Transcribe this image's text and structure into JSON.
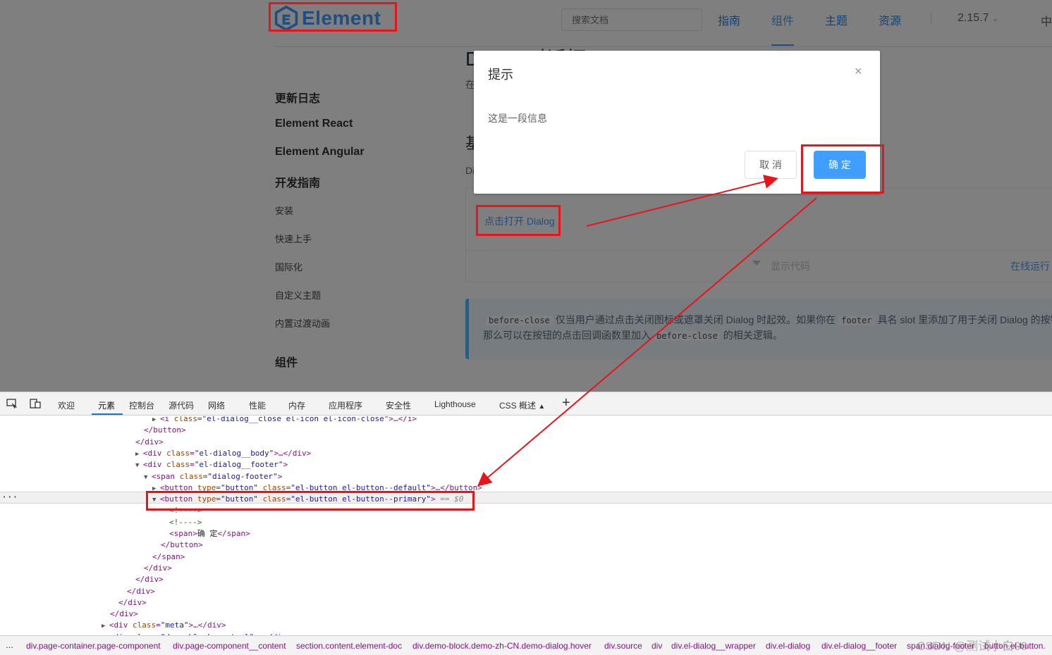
{
  "nav": {
    "logo_text": "Element",
    "search_placeholder": "搜索文档",
    "items": [
      "指南",
      "组件",
      "主题",
      "资源"
    ],
    "version": "2.15.7",
    "lang": "中"
  },
  "sidebar": {
    "groups": [
      "更新日志",
      "Element React",
      "Element Angular",
      "开发指南"
    ],
    "sub_items": [
      "安装",
      "快速上手",
      "国际化",
      "自定义主题",
      "内置过渡动画"
    ],
    "group_components": "组件"
  },
  "content": {
    "title": "Dialog 对话框",
    "intro": "在",
    "section_heading": "基",
    "section_desc": "Di",
    "open_button": "点击打开 Dialog",
    "show_code": "显示代码",
    "run_online": "在线运行",
    "tip_line1_code1": "before-close",
    "tip_line1_text1": "仅当用户通过点击关闭图标或遮罩关闭 Dialog 时起效。如果你在",
    "tip_line1_code2": "footer",
    "tip_line1_text2": "具名 slot 里添加了用于关闭 Dialog 的按钮",
    "tip_line2_text1": "那么可以在按钮的点击回调函数里加入",
    "tip_line2_code": "before-close",
    "tip_line2_text2": "的相关逻辑。"
  },
  "dialog": {
    "title": "提示",
    "close": "×",
    "body": "这是一段信息",
    "cancel": "取 消",
    "confirm": "确 定"
  },
  "devtools": {
    "tabs": [
      "欢迎",
      "元素",
      "控制台",
      "源代码",
      "网络",
      "性能",
      "内存",
      "应用程序",
      "安全性",
      "Lighthouse",
      "CSS 概述"
    ],
    "active_tab": "元素",
    "plus": "+",
    "dom_lines": [
      {
        "indent": 18,
        "tri": "▶",
        "tag_open": "<i ",
        "attr": "class",
        "val": "\"el-dialog__close el-icon el-icon-close\"",
        "rest": ">…</i>"
      },
      {
        "indent": 17,
        "tri": "",
        "tag_open": "</button>",
        "attr": "",
        "val": "",
        "rest": ""
      },
      {
        "indent": 16,
        "tri": "",
        "tag_open": "</div>",
        "attr": "",
        "val": "",
        "rest": ""
      },
      {
        "indent": 16,
        "tri": "▶",
        "tag_open": "<div ",
        "attr": "class",
        "val": "\"el-dialog__body\"",
        "rest": ">…</div>"
      },
      {
        "indent": 16,
        "tri": "▼",
        "tag_open": "<div ",
        "attr": "class",
        "val": "\"el-dialog__footer\"",
        "rest": ">"
      },
      {
        "indent": 17,
        "tri": "▼",
        "tag_open": "<span ",
        "attr": "class",
        "val": "\"dialog-footer\"",
        "rest": ">"
      },
      {
        "indent": 18,
        "tri": "▶",
        "tag_open": "<button ",
        "attr": "type",
        "val": "\"button\"",
        "attr2": "class",
        "val2": "\"el-button el-button--default\"",
        "rest": ">…</button>"
      },
      {
        "indent": 18,
        "tri": "▼",
        "tag_open": "<button ",
        "attr": "type",
        "val": "\"button\"",
        "attr2": "class",
        "val2": "\"el-button el-button--primary\"",
        "rest": ">",
        "eq": "== $0"
      },
      {
        "indent": 20,
        "tri": "",
        "comment": "<!---->"
      },
      {
        "indent": 20,
        "tri": "",
        "comment": "<!---->"
      },
      {
        "indent": 20,
        "tri": "",
        "tag_open": "<span>",
        "text": "确 定",
        "rest": "</span>"
      },
      {
        "indent": 19,
        "tri": "",
        "tag_open": "</button>",
        "attr": "",
        "val": "",
        "rest": ""
      },
      {
        "indent": 18,
        "tri": "",
        "tag_open": "</span>",
        "attr": "",
        "val": "",
        "rest": ""
      },
      {
        "indent": 17,
        "tri": "",
        "tag_open": "</div>",
        "attr": "",
        "val": "",
        "rest": ""
      },
      {
        "indent": 16,
        "tri": "",
        "tag_open": "</div>",
        "attr": "",
        "val": "",
        "rest": ""
      },
      {
        "indent": 15,
        "tri": "",
        "tag_open": "</div>",
        "attr": "",
        "val": "",
        "rest": ""
      },
      {
        "indent": 14,
        "tri": "",
        "tag_open": "</div>",
        "attr": "",
        "val": "",
        "rest": ""
      },
      {
        "indent": 13,
        "tri": "",
        "tag_open": "</div>",
        "attr": "",
        "val": "",
        "rest": ""
      },
      {
        "indent": 12,
        "tri": "▶",
        "tag_open": "<div ",
        "attr": "class",
        "val": "\"meta\"",
        "rest": ">…</div>"
      },
      {
        "indent": 12,
        "tri": "▶",
        "tag_open": "<div ",
        "attr": "class",
        "val": "\"demo-block-control\"",
        "rest": ">…</div>"
      }
    ],
    "crumbs_dots": "...",
    "crumbs": [
      "div.page-container.page-component",
      "div.page-component__content",
      "section.content.element-doc",
      "div.demo-block.demo-zh-CN.demo-dialog.hover",
      "div.source",
      "div",
      "div.el-dialog__wrapper",
      "div.el-dialog",
      "div.el-dialog__footer",
      "span.dialog-footer",
      "button.el-button."
    ],
    "left_ellipsis": "···"
  },
  "watermark": "CSDN @测试小白00",
  "colors": {
    "primary": "#409eff",
    "annotation": "#e8141b",
    "mask": "rgba(0,0,0,0.5)"
  }
}
